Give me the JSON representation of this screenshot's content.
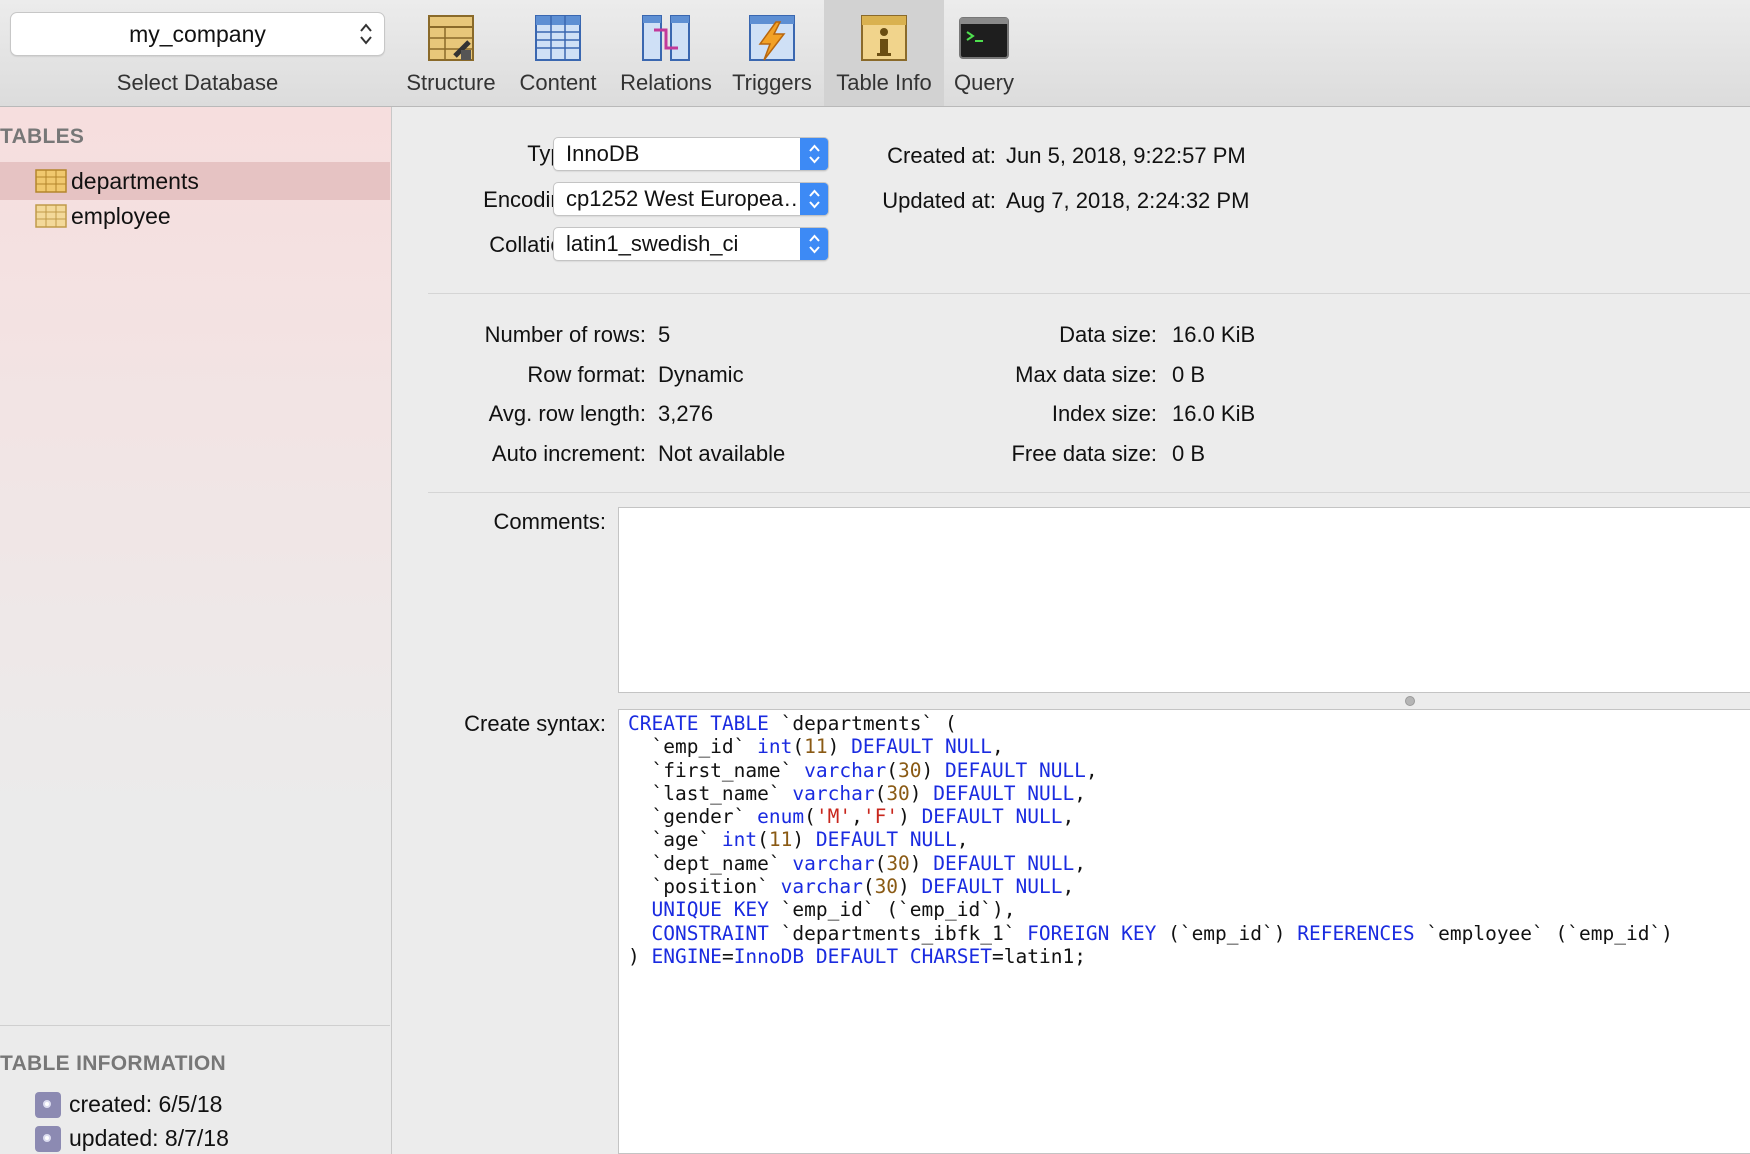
{
  "toolbar": {
    "database_value": "my_company",
    "database_label": "Select Database",
    "buttons": [
      {
        "label": "Structure",
        "icon": "structure-icon"
      },
      {
        "label": "Content",
        "icon": "content-icon"
      },
      {
        "label": "Relations",
        "icon": "relations-icon"
      },
      {
        "label": "Triggers",
        "icon": "triggers-icon"
      },
      {
        "label": "Table Info",
        "icon": "table-info-icon",
        "active": true
      },
      {
        "label": "Query",
        "icon": "terminal-icon"
      }
    ]
  },
  "sidebar": {
    "tables_header": "TABLES",
    "tables": [
      {
        "name": "departments",
        "selected": true
      },
      {
        "name": "employee",
        "selected": false
      }
    ],
    "info_header": "TABLE INFORMATION",
    "info_items": [
      "created: 6/5/18",
      "updated: 8/7/18"
    ]
  },
  "table_info": {
    "type_label": "Type:",
    "type_value": "InnoDB",
    "encoding_label": "Encoding:",
    "encoding_value": "cp1252 West Europea…",
    "collation_label": "Collation:",
    "collation_value": "latin1_swedish_ci",
    "created_label": "Created at:",
    "created_value": "Jun 5, 2018, 9:22:57 PM",
    "updated_label": "Updated at:",
    "updated_value": "Aug 7, 2018, 2:24:32 PM",
    "rows_label": "Number of rows:",
    "rows_value": "5",
    "row_format_label": "Row format:",
    "row_format_value": "Dynamic",
    "avg_row_label": "Avg. row length:",
    "avg_row_value": "3,276",
    "auto_inc_label": "Auto increment:",
    "auto_inc_value": "Not available",
    "data_size_label": "Data size:",
    "data_size_value": "16.0 KiB",
    "max_data_label": "Max data size:",
    "max_data_value": "0 B",
    "index_size_label": "Index size:",
    "index_size_value": "16.0 KiB",
    "free_data_label": "Free data size:",
    "free_data_value": "0 B",
    "comments_label": "Comments:",
    "comments_value": "",
    "syntax_label": "Create syntax:",
    "syntax_lines": [
      "CREATE TABLE `departments` (",
      "  `emp_id` int(11) DEFAULT NULL,",
      "  `first_name` varchar(30) DEFAULT NULL,",
      "  `last_name` varchar(30) DEFAULT NULL,",
      "  `gender` enum('M','F') DEFAULT NULL,",
      "  `age` int(11) DEFAULT NULL,",
      "  `dept_name` varchar(30) DEFAULT NULL,",
      "  `position` varchar(30) DEFAULT NULL,",
      "  UNIQUE KEY `emp_id` (`emp_id`),",
      "  CONSTRAINT `departments_ibfk_1` FOREIGN KEY (`emp_id`) REFERENCES `employee` (`emp_id`)",
      ") ENGINE=InnoDB DEFAULT CHARSET=latin1;"
    ]
  }
}
